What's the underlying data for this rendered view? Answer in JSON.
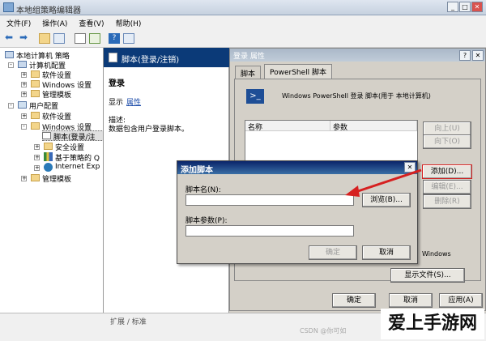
{
  "window": {
    "title": "本地组策略编辑器",
    "btn_min": "_",
    "btn_max": "□",
    "btn_close": "✕"
  },
  "menu": [
    "文件(F)",
    "操作(A)",
    "查看(V)",
    "帮助(H)"
  ],
  "tree": {
    "root": "本地计算机 策略",
    "computer": "计算机配置",
    "software": "软件设置",
    "windows": "Windows 设置",
    "admin": "管理模板",
    "user": "用户配置",
    "u_software": "软件设置",
    "u_windows": "Windows 设置",
    "script": "脚本(登录/注",
    "security": "安全设置",
    "policy": "基于策略的 Q",
    "ie": "Internet Exp",
    "u_admin": "管理模板"
  },
  "middle": {
    "header": "脚本(登录/注销)",
    "section": "登录",
    "show": "显示",
    "properties": "属性",
    "desc_label": "描述:",
    "desc": "数据包含用户登录脚本。"
  },
  "props": {
    "title": "登录 属性",
    "help": "?",
    "close": "✕",
    "tab1": "脚本",
    "tab2": "PowerShell 脚本",
    "heading": "Windows PowerShell 登录 脚本(用于 本地计算机)",
    "col_name": "名称",
    "col_params": "参数",
    "up": "向上(U)",
    "down": "向下(O)",
    "add": "添加(D)...",
    "edit": "编辑(E)...",
    "remove": "删除(R)",
    "note": "Windows",
    "show_files": "显示文件(S)...",
    "ok": "确定",
    "cancel": "取消",
    "apply": "应用(A)"
  },
  "add_dialog": {
    "title": "添加脚本",
    "close": "✕",
    "name_label": "脚本名(N):",
    "name_value": "",
    "browse": "浏览(B)...",
    "params_label": "脚本参数(P):",
    "params_value": "",
    "ok": "确定",
    "cancel": "取消"
  },
  "statusbar": {
    "tabs": "扩展 / 标准",
    "csdn": "CSDN @你可如"
  },
  "watermark": "爱上手游网",
  "colors": {
    "accent": "#0b3a78",
    "arrow": "#d62020"
  }
}
